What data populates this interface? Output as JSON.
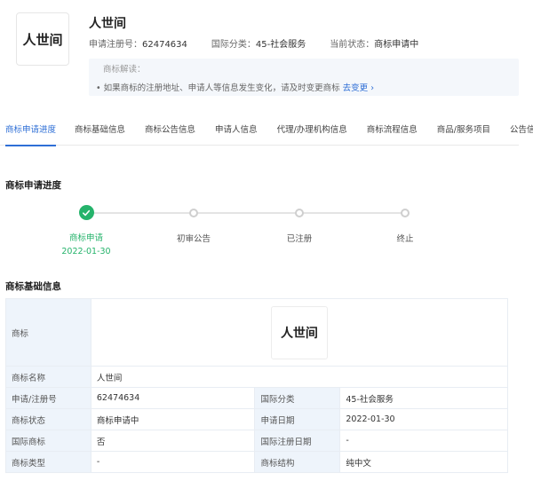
{
  "header": {
    "logo_text": "人世间",
    "name": "人世间",
    "reg_no_label": "申请注册号：",
    "reg_no": "62474634",
    "class_label": "国际分类：",
    "class_value": "45-社会服务",
    "status_label": "当前状态：",
    "status_value": "商标申请中"
  },
  "note": {
    "title": "商标解读：",
    "line": "• 如果商标的注册地址、申请人等信息发生变化，请及时变更商标",
    "link": "去变更",
    "link_icon": "chevron-right-icon"
  },
  "tabs": [
    "商标申请进度",
    "商标基础信息",
    "商标公告信息",
    "申请人信息",
    "代理/办理机构信息",
    "商标流程信息",
    "商品/服务项目",
    "公告信息"
  ],
  "active_tab": 0,
  "progress": {
    "title": "商标申请进度",
    "steps": [
      {
        "label": "商标申请",
        "date": "2022-01-30",
        "done": true
      },
      {
        "label": "初审公告",
        "date": "",
        "done": false
      },
      {
        "label": "已注册",
        "date": "",
        "done": false
      },
      {
        "label": "终止",
        "date": "",
        "done": false
      }
    ],
    "done_color": "#25b36b"
  },
  "basic": {
    "title": "商标基础信息",
    "logo_label": "商标",
    "logo_text": "人世间",
    "name_label": "商标名称",
    "name_value": "人世间",
    "rows": [
      {
        "l1": "申请/注册号",
        "v1": "62474634",
        "l2": "国际分类",
        "v2": "45-社会服务"
      },
      {
        "l1": "商标状态",
        "v1": "商标申请中",
        "l2": "申请日期",
        "v2": "2022-01-30"
      },
      {
        "l1": "国际商标",
        "v1": "否",
        "l2": "国际注册日期",
        "v2": "-"
      },
      {
        "l1": "商标类型",
        "v1": "-",
        "l2": "商标结构",
        "v2": "纯中文"
      }
    ]
  },
  "colors": {
    "accent": "#2f6fd6",
    "success": "#25b36b",
    "label_bg": "#eef4fb"
  }
}
